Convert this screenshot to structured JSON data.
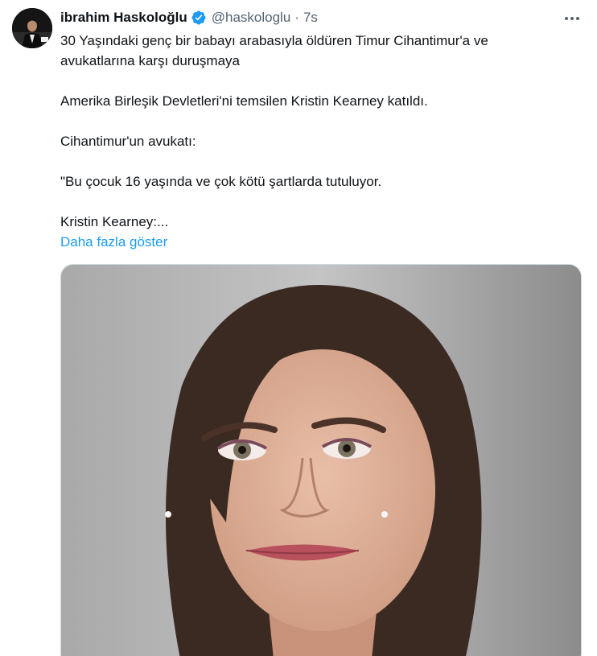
{
  "author": {
    "display_name": "ibrahim Haskoloğlu",
    "handle": "@haskologlu",
    "time": "7s",
    "separator": "·"
  },
  "tweet": {
    "paragraphs": [
      "30 Yaşındaki genç bir babayı arabasıyla öldüren Timur Cihantimur'a ve avukatlarına karşı duruşmaya",
      "Amerika Birleşik Devletleri'ni temsilen Kristin Kearney katıldı.",
      "Cihantimur'un avukatı:",
      "\"Bu çocuk 16 yaşında ve çok kötü şartlarda tutuluyor.",
      "Kristin Kearney:..."
    ],
    "show_more": "Daha fazla göster"
  },
  "icons": {
    "verified": "verified-badge-icon",
    "more": "more-horizontal-icon"
  },
  "colors": {
    "link": "#1d9bf0",
    "secondary_text": "#536471",
    "verified": "#1d9bf0"
  }
}
